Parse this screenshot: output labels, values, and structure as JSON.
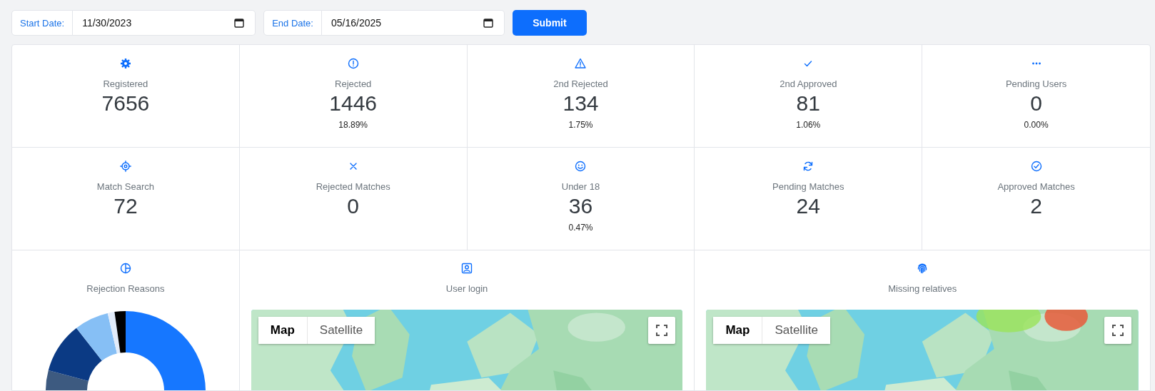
{
  "filters": [
    {
      "label": "Start Date:",
      "value": "11/30/2023"
    },
    {
      "label": "End Date:",
      "value": "05/16/2025"
    }
  ],
  "submit": "Submit",
  "stats": [
    {
      "label": "Registered",
      "value": "7656"
    },
    {
      "label": "Rejected",
      "value": "1446",
      "percent": "18.89%"
    },
    {
      "label": "2nd Rejected",
      "value": "134",
      "percent": "1.75%"
    },
    {
      "label": "2nd Approved",
      "value": "81",
      "percent": "1.06%"
    },
    {
      "label": "Pending Users",
      "value": "0",
      "percent": "0.00%"
    },
    {
      "label": "Match Search",
      "value": "72"
    },
    {
      "label": "Rejected Matches",
      "value": "0"
    },
    {
      "label": "Under 18",
      "value": "36",
      "percent": "0.47%"
    },
    {
      "label": "Pending Matches",
      "value": "24"
    },
    {
      "label": "Approved Matches",
      "value": "2"
    }
  ],
  "panels": [
    {
      "kind": "donut",
      "title": "Rejection Reasons"
    },
    {
      "kind": "map",
      "title": "User login",
      "map_types": [
        {
          "label": "Map",
          "selected": true
        },
        {
          "label": "Satellite",
          "selected": false
        }
      ],
      "heat": false
    },
    {
      "kind": "map",
      "title": "Missing relatives",
      "map_types": [
        {
          "label": "Map",
          "selected": true
        },
        {
          "label": "Satellite",
          "selected": false
        }
      ],
      "heat": true
    }
  ]
}
